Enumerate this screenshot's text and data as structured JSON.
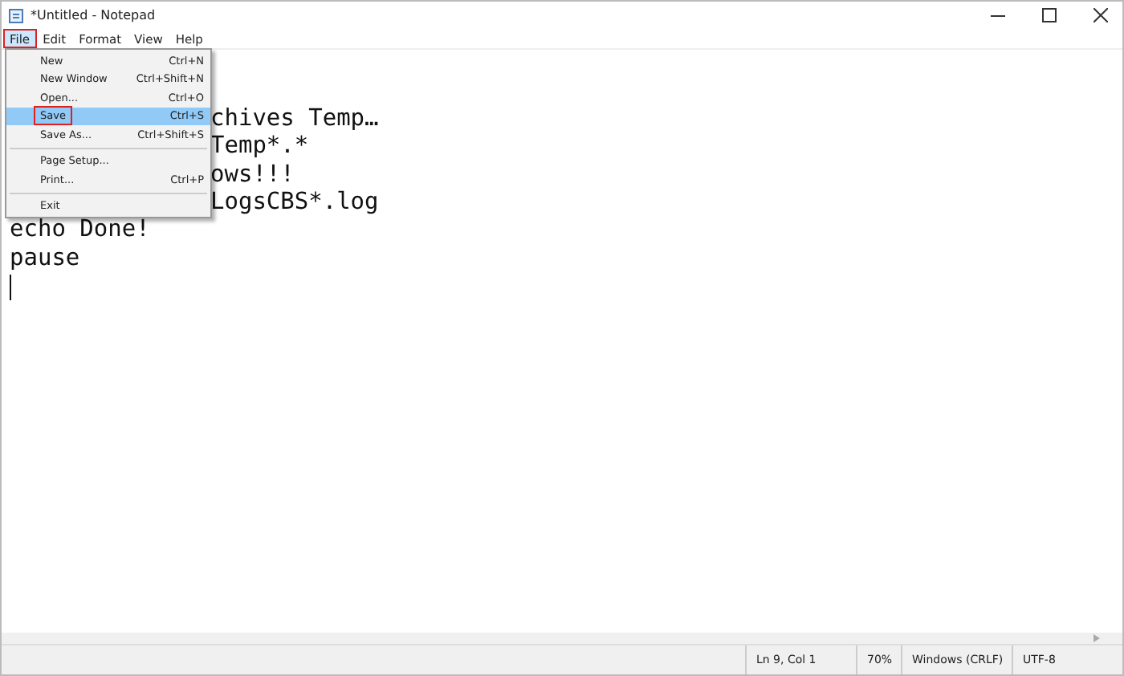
{
  "window": {
    "title": "*Untitled - Notepad"
  },
  "menu_bar": [
    {
      "label": "File",
      "selected": true,
      "outlined": true
    },
    {
      "label": "Edit",
      "selected": false,
      "outlined": false
    },
    {
      "label": "Format",
      "selected": false,
      "outlined": false
    },
    {
      "label": "View",
      "selected": false,
      "outlined": false
    },
    {
      "label": "Help",
      "selected": false,
      "outlined": false
    }
  ],
  "file_menu": [
    {
      "kind": "item",
      "label": "New",
      "shortcut": "Ctrl+N",
      "selected": false,
      "outlined": false
    },
    {
      "kind": "item",
      "label": "New Window",
      "shortcut": "Ctrl+Shift+N",
      "selected": false,
      "outlined": false
    },
    {
      "kind": "item",
      "label": "Open...",
      "shortcut": "Ctrl+O",
      "selected": false,
      "outlined": false
    },
    {
      "kind": "item",
      "label": "Save",
      "shortcut": "Ctrl+S",
      "selected": true,
      "outlined": true
    },
    {
      "kind": "item",
      "label": "Save As...",
      "shortcut": "Ctrl+Shift+S",
      "selected": false,
      "outlined": false
    },
    {
      "kind": "separator"
    },
    {
      "kind": "item",
      "label": "Page Setup...",
      "selected": false,
      "outlined": false
    },
    {
      "kind": "item",
      "label": "Print...",
      "shortcut": "Ctrl+P",
      "selected": false,
      "outlined": false
    },
    {
      "kind": "separator"
    },
    {
      "kind": "item",
      "label": "Exit",
      "selected": false,
      "outlined": false
    }
  ],
  "editor_lines": [
    {
      "kind": "blank"
    },
    {
      "kind": "blank"
    },
    {
      "kind": "partial",
      "text": "chives Temp…"
    },
    {
      "kind": "partial",
      "text": "Temp*.*"
    },
    {
      "kind": "partial",
      "text": "ows!!!"
    },
    {
      "kind": "partial",
      "text": "LogsCBS*.log"
    },
    {
      "kind": "full",
      "text": "echo Done!"
    },
    {
      "kind": "full",
      "text": "pause"
    },
    {
      "kind": "caret"
    }
  ],
  "status_bar": {
    "position": "Ln 9, Col 1",
    "zoom": "70%",
    "line_ending": "Windows (CRLF)",
    "encoding": "UTF-8"
  }
}
